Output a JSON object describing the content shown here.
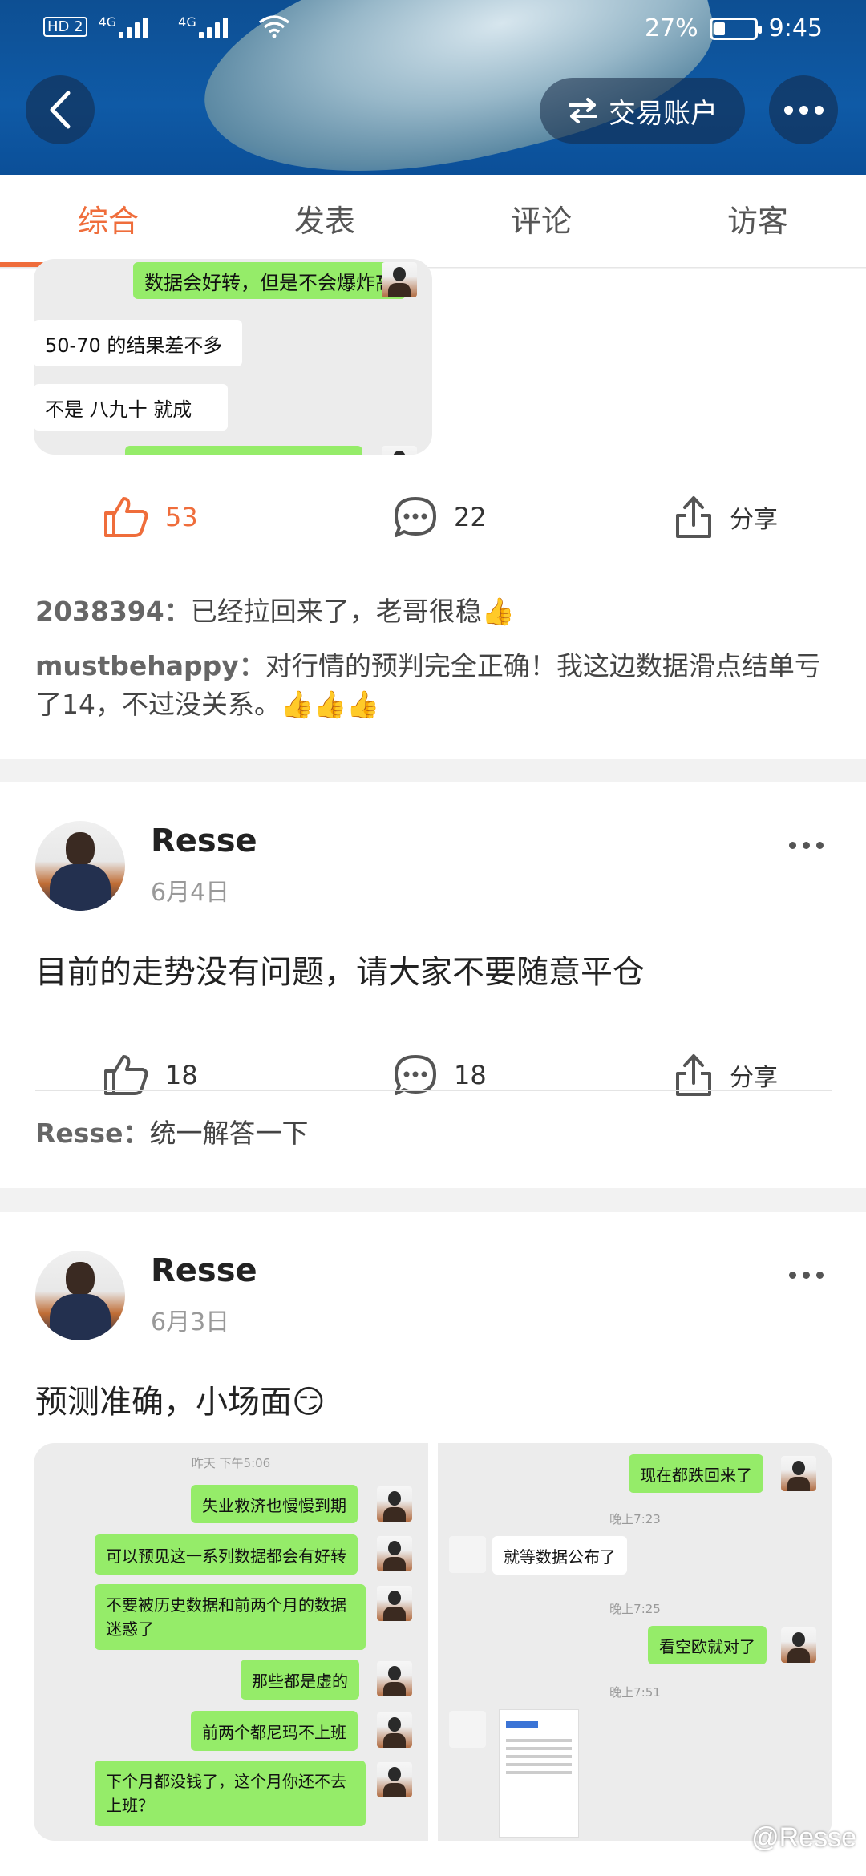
{
  "status_bar": {
    "network": "HD 2",
    "signal_1": "4G",
    "signal_2": "4G",
    "battery": "27%",
    "time": "9:45"
  },
  "header": {
    "trade_account_label": "交易账户"
  },
  "tabs": [
    {
      "label": "综合",
      "active": true
    },
    {
      "label": "发表",
      "active": false
    },
    {
      "label": "评论",
      "active": false
    },
    {
      "label": "访客",
      "active": false
    }
  ],
  "post1": {
    "chat": [
      {
        "text": "数据会好转，但是不会爆炸高",
        "side": "right"
      },
      {
        "text": "50-70 的结果差不多",
        "side": "left"
      },
      {
        "text": "不是  八九十  就成",
        "side": "left"
      }
    ],
    "likes": "53",
    "comments_count": "22",
    "share_label": "分享",
    "comments": [
      {
        "user": "2038394：",
        "text": "已经拉回来了，老哥很稳👍"
      },
      {
        "user": "mustbehappy：",
        "text": "对行情的预判完全正确！我这边数据滑点结单亏了14，不过没关系。👍👍👍"
      }
    ]
  },
  "post2": {
    "user": "Resse",
    "date": "6月4日",
    "text": "目前的走势没有问题，请大家不要随意平仓",
    "likes": "18",
    "comments_count": "18",
    "share_label": "分享",
    "comments": [
      {
        "user": "Resse：",
        "text": "统一解答一下"
      }
    ]
  },
  "post3": {
    "user": "Resse",
    "date": "6月3日",
    "text": "预测准确，小场面😏",
    "chat_left": {
      "timestamp": "昨天 下午5:06",
      "messages": [
        "失业救济也慢慢到期",
        "可以预见这一系列数据都会有好转",
        "不要被历史数据和前两个月的数据迷惑了",
        "那些都是虚的",
        "前两个都尼玛不上班",
        "下个月都没钱了，这个月你还不去上班？"
      ]
    },
    "chat_right": {
      "messages": [
        {
          "text": "现在都跌回来了",
          "side": "right"
        },
        {
          "time": "晚上7:23"
        },
        {
          "text": "就等数据公布了",
          "side": "left"
        },
        {
          "time": "晚上7:25"
        },
        {
          "text": "看空欧就对了",
          "side": "right"
        },
        {
          "time": "晚上7:51"
        }
      ]
    }
  },
  "watermark": "@Resse"
}
